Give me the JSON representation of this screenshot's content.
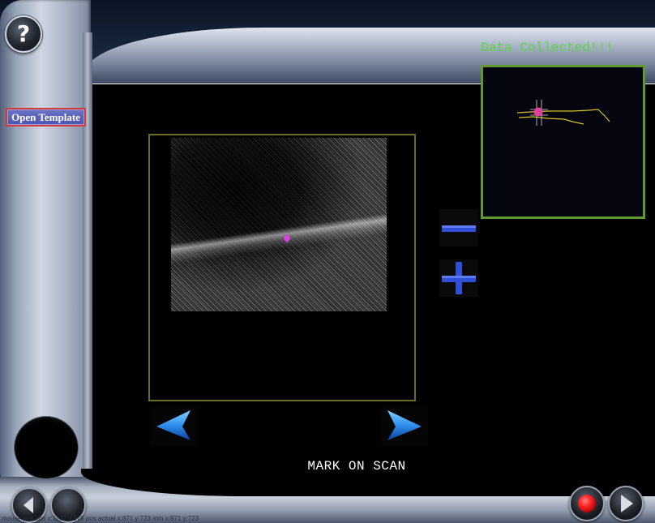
{
  "header": {
    "help_label": "?",
    "status_message": "Data Collected!!!"
  },
  "sidebar": {
    "open_template_label": "Open Template"
  },
  "viewer": {
    "instruction": "MARK ON SCAN",
    "marker_color": "#e040e0",
    "frame_color": "#6d6a2a"
  },
  "zoom": {
    "minus_icon": "minus-icon",
    "plus_icon": "plus-icon",
    "icon_color": "#2e4fd6"
  },
  "navigation": {
    "prev_icon": "arrow-left-icon",
    "next_icon": "arrow-right-icon",
    "arrow_color": "#2f8ff0"
  },
  "thumbnail": {
    "border_color": "#5f9a2e",
    "trace_color": "#d8c230",
    "marker_color": "#e0409a"
  },
  "footer": {
    "back_icon": "chevron-left-icon",
    "record_icon": "record-icon",
    "play_icon": "play-icon",
    "record_color": "#ff2020",
    "status_line": "mouse pos abs x:1137 y:978 pos actual x:871 y:723 mm x:871 y:723"
  }
}
